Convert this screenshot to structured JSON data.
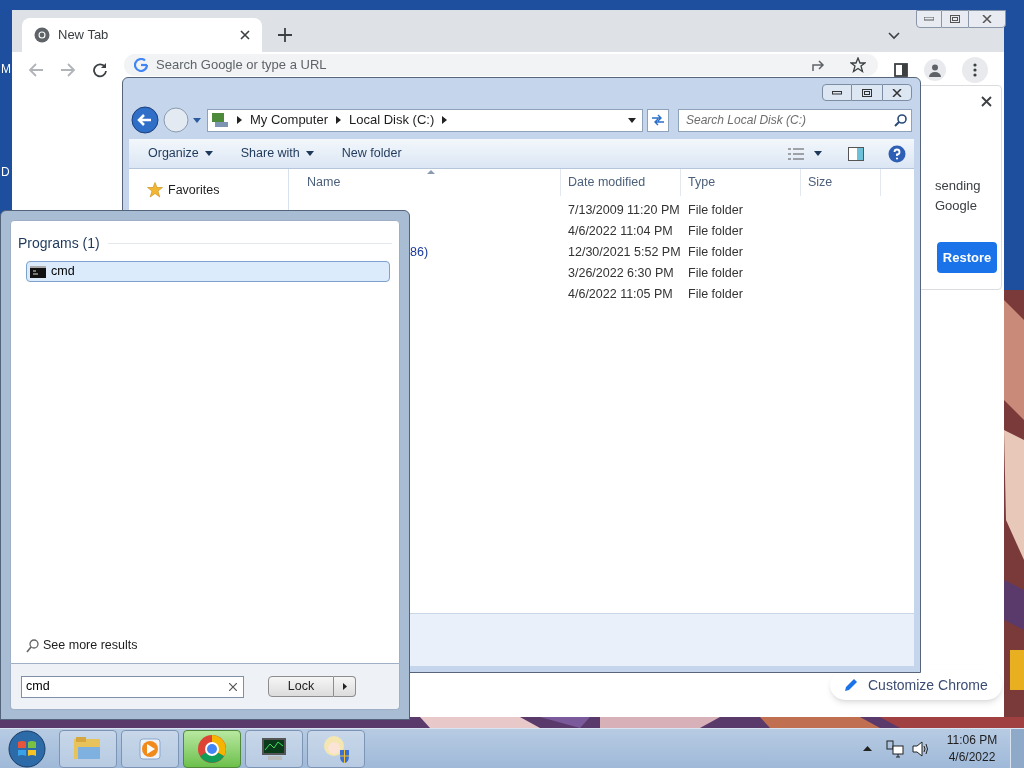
{
  "desktop": {
    "labels": [
      "M",
      "D"
    ]
  },
  "browser": {
    "tab": {
      "title": "New Tab",
      "selected": true
    },
    "omnibox": {
      "placeholder": "Search Google or type a URL"
    },
    "panel": {
      "lines": [
        "sending",
        "Google"
      ],
      "button": "Restore"
    },
    "customize_button": "Customize Chrome"
  },
  "explorer": {
    "breadcrumb": [
      "My Computer",
      "Local Disk (C:)"
    ],
    "search": {
      "placeholder": "Search Local Disk (C:)"
    },
    "toolbar": [
      {
        "label": "Organize",
        "dropdown": true
      },
      {
        "label": "Share with",
        "dropdown": true
      },
      {
        "label": "New folder",
        "dropdown": false
      }
    ],
    "nav": [
      "Favorites"
    ],
    "columns": [
      "Name",
      "Date modified",
      "Type",
      "Size"
    ],
    "rows": [
      {
        "date": "7/13/2009 11:20 PM",
        "type": "File folder"
      },
      {
        "date": "4/6/2022 11:04 PM",
        "type": "File folder"
      },
      {
        "name": "86)",
        "date": "12/30/2021 5:52 PM",
        "type": "File folder"
      },
      {
        "date": "3/26/2022 6:30 PM",
        "type": "File folder"
      },
      {
        "date": "4/6/2022 11:05 PM",
        "type": "File folder"
      }
    ]
  },
  "start_menu": {
    "group": "Programs (1)",
    "results": [
      {
        "label": "cmd",
        "selected": true
      }
    ],
    "see_more": "See more results",
    "search": {
      "value": "cmd"
    },
    "power_button": "Lock"
  },
  "taskbar": {
    "apps": [
      {
        "kind": "explorer",
        "active": false
      },
      {
        "kind": "media",
        "active": false
      },
      {
        "kind": "chrome",
        "active": true
      },
      {
        "kind": "monitor",
        "active": false
      },
      {
        "kind": "app",
        "active": false
      }
    ],
    "clock": {
      "time": "11:06 PM",
      "date": "4/6/2022"
    }
  }
}
